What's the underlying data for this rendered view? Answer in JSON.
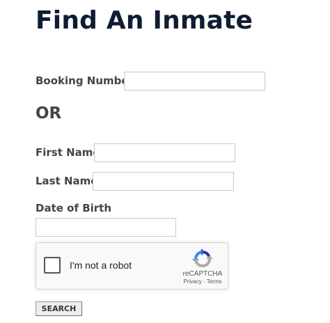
{
  "page": {
    "title": "Find An Inmate"
  },
  "form": {
    "booking_number": {
      "label": "Booking Number",
      "value": ""
    },
    "separator": "OR",
    "first_name": {
      "label": "First Name",
      "value": ""
    },
    "last_name": {
      "label": "Last Name",
      "value": ""
    },
    "date_of_birth": {
      "label": "Date of Birth",
      "value": ""
    },
    "recaptcha": {
      "checkbox_label": "I'm not a robot",
      "brand": "reCAPTCHA",
      "privacy_link": "Privacy",
      "link_separator": " - ",
      "terms_link": "Terms",
      "icon": "recaptcha-logo-icon"
    },
    "search_label": "SEARCH"
  },
  "colors": {
    "title": "#0f1d33",
    "label": "#444444",
    "input_border": "#c9c9c9",
    "recaptcha_blue_dark": "#1c3aa9",
    "recaptcha_blue": "#4285f4",
    "recaptcha_gray": "#ababab"
  }
}
